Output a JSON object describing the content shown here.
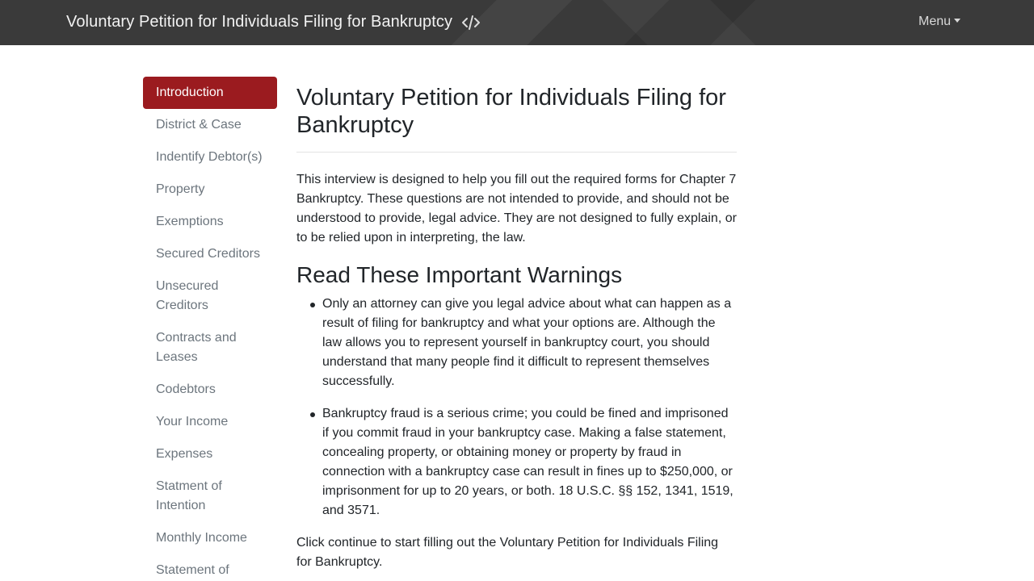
{
  "navbar": {
    "title": "Voluntary Petition for Individuals Filing for Bankruptcy",
    "code_icon": "code-icon",
    "menu_label": "Menu"
  },
  "sidebar": {
    "items": [
      {
        "label": "Introduction",
        "active": true
      },
      {
        "label": "District & Case"
      },
      {
        "label": "Indentify Debtor(s)"
      },
      {
        "label": "Property"
      },
      {
        "label": "Exemptions"
      },
      {
        "label": "Secured Creditors"
      },
      {
        "label": "Unsecured Creditors"
      },
      {
        "label": "Contracts and Leases"
      },
      {
        "label": "Codebtors"
      },
      {
        "label": "Your Income"
      },
      {
        "label": "Expenses"
      },
      {
        "label": "Statment of Intention"
      },
      {
        "label": "Monthly Income"
      },
      {
        "label": "Statement of"
      }
    ]
  },
  "main": {
    "title": "Voluntary Petition for Individuals Filing for Bankruptcy",
    "intro": "This interview is designed to help you fill out the required forms for Chapter 7 Bankruptcy. These questions are not intended to provide, and should not be understood to provide, legal advice. They are not designed to fully explain, or to be relied upon in interpreting, the law.",
    "warnings_heading": "Read These Important Warnings",
    "warnings": [
      "Only an attorney can give you legal advice about what can happen as a result of filing for bankruptcy and what your options are. Although the law allows you to represent yourself in bankruptcy court, you should understand that many people find it difficult to represent themselves successfully.",
      "Bankruptcy fraud is a serious crime; you could be fined and imprisoned if you commit fraud in your bankruptcy case. Making a false statement, concealing property, or obtaining money or property by fraud in connection with a bankruptcy case can result in fines up to $250,000, or imprisonment for up to 20 years, or both. 18 U.S.C. §§ 152, 1341, 1519, and 3571."
    ],
    "closing": "Click continue to start filling out the Voluntary Petition for Individuals Filing for Bankruptcy."
  },
  "colors": {
    "navbar_bg": "#3a3a3a",
    "active_item_bg": "#9b1b1f",
    "sidebar_text": "#6c757d"
  }
}
